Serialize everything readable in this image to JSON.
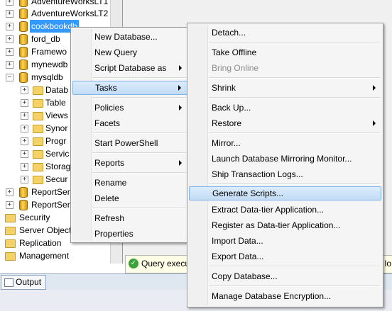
{
  "tree": {
    "items": [
      {
        "label": "AdventureWorksLT1",
        "type": "db",
        "exp": "+"
      },
      {
        "label": "AdventureWorksLT2",
        "type": "db",
        "exp": "+"
      },
      {
        "label": "cookbookdb",
        "type": "db",
        "exp": "+"
      },
      {
        "label": "ford_db",
        "type": "db",
        "exp": "+"
      },
      {
        "label": "Framewo",
        "type": "db",
        "exp": "+"
      },
      {
        "label": "mynewdb",
        "type": "db",
        "exp": "+"
      },
      {
        "label": "mysqldb",
        "type": "db",
        "exp": "−"
      },
      {
        "label": "Datab",
        "type": "folder",
        "exp": "+"
      },
      {
        "label": "Table",
        "type": "folder",
        "exp": "+"
      },
      {
        "label": "Views",
        "type": "folder",
        "exp": "+"
      },
      {
        "label": "Synor",
        "type": "folder",
        "exp": "+"
      },
      {
        "label": "Progr",
        "type": "folder",
        "exp": "+"
      },
      {
        "label": "Servic",
        "type": "folder",
        "exp": "+"
      },
      {
        "label": "Storag",
        "type": "folder",
        "exp": "+"
      },
      {
        "label": "Secur",
        "type": "folder",
        "exp": "+"
      },
      {
        "label": "ReportSer",
        "type": "db",
        "exp": "+"
      },
      {
        "label": "ReportSer",
        "type": "db",
        "exp": "+"
      },
      {
        "label": "Security",
        "type": "folder",
        "exp": "+"
      },
      {
        "label": "Server Object",
        "type": "folder",
        "exp": "+"
      },
      {
        "label": "Replication",
        "type": "folder",
        "exp": "+"
      },
      {
        "label": "Management",
        "type": "folder",
        "exp": "+"
      }
    ]
  },
  "status": {
    "text": "Query execu",
    "right_text": "lo"
  },
  "output_tab": {
    "label": "Output"
  },
  "context_menu": {
    "items": [
      "New Database...",
      "New Query",
      "Script Database as",
      "Tasks",
      "Policies",
      "Facets",
      "Start PowerShell",
      "Reports",
      "Rename",
      "Delete",
      "Refresh",
      "Properties"
    ]
  },
  "tasks_menu": {
    "items": [
      "Detach...",
      "Take Offline",
      "Bring Online",
      "Shrink",
      "Back Up...",
      "Restore",
      "Mirror...",
      "Launch Database Mirroring Monitor...",
      "Ship Transaction Logs...",
      "Generate Scripts...",
      "Extract Data-tier Application...",
      "Register as Data-tier Application...",
      "Import Data...",
      "Export Data...",
      "Copy Database...",
      "Manage Database Encryption..."
    ]
  },
  "colors": {
    "selection": "#3399ff",
    "highlight": "#c2dcf5"
  }
}
